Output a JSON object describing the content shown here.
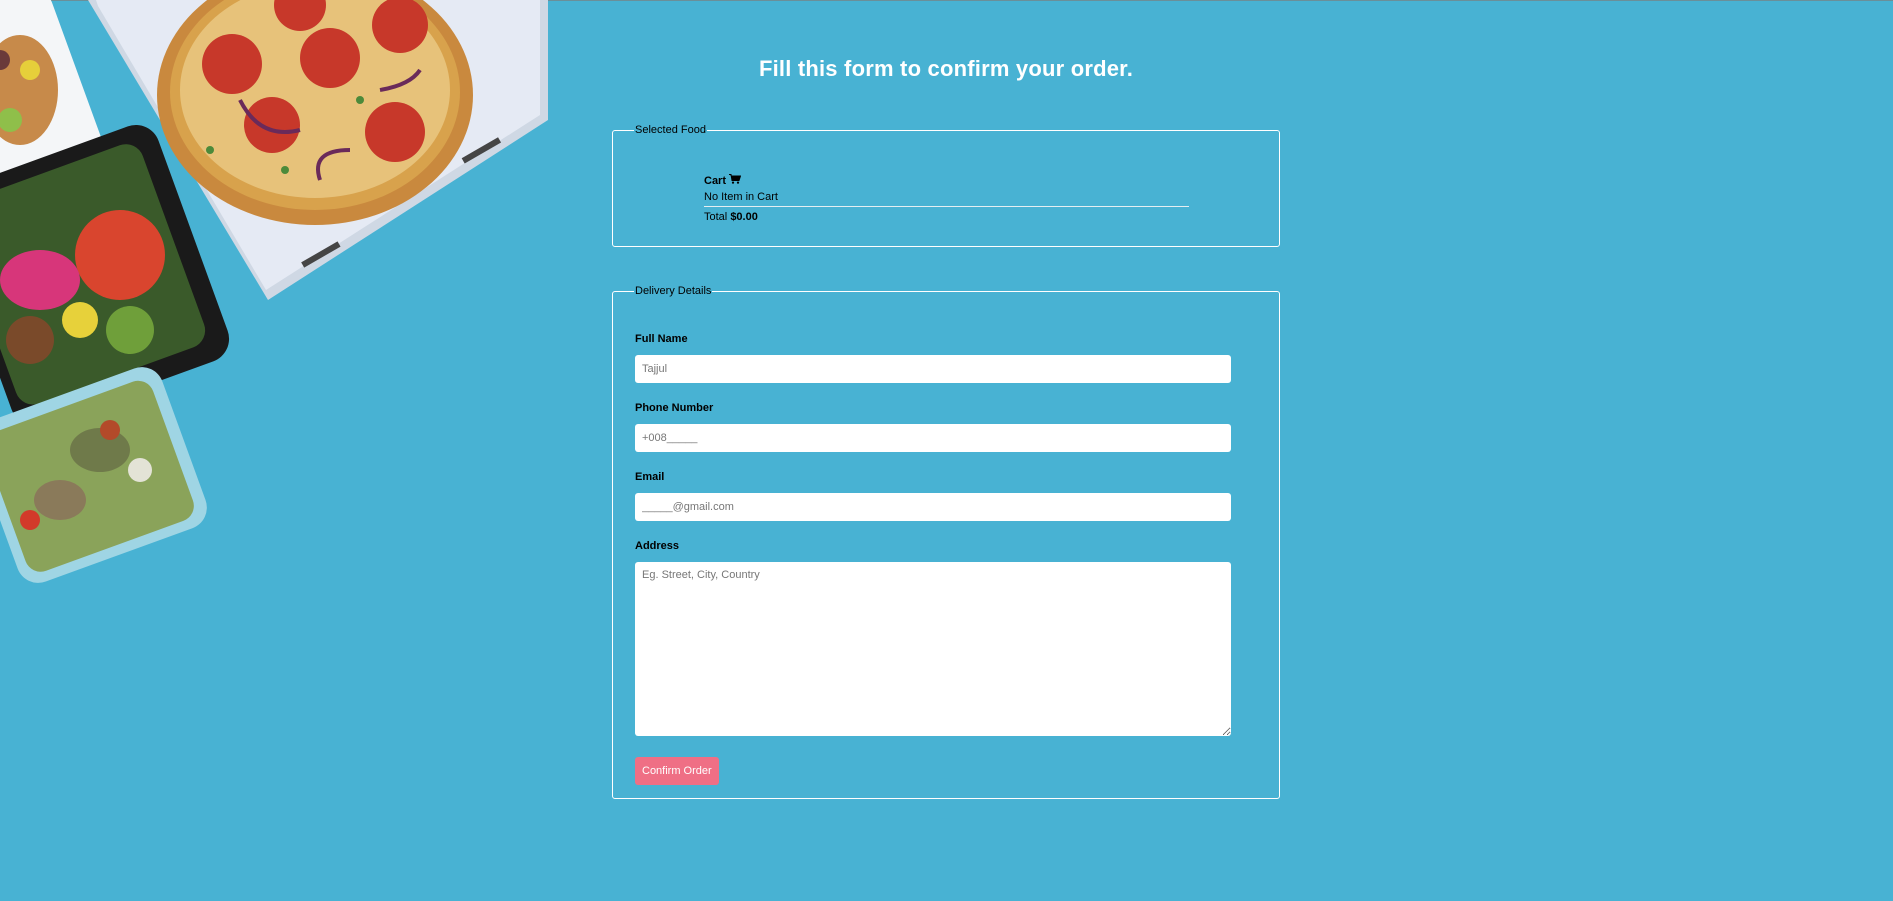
{
  "page": {
    "title": "Fill this form to confirm your order.",
    "background_color": "#48b2d3"
  },
  "selected_food": {
    "legend": "Selected Food",
    "cart_title": "Cart",
    "cart_icon": "shopping-cart-icon",
    "empty_message": "No Item in Cart",
    "total_label": "Total",
    "total_value": "$0.00"
  },
  "delivery": {
    "legend": "Delivery Details",
    "full_name": {
      "label": "Full Name",
      "placeholder": "Tajjul"
    },
    "phone": {
      "label": "Phone Number",
      "placeholder": "+008_____"
    },
    "email": {
      "label": "Email",
      "placeholder": "_____@gmail.com"
    },
    "address": {
      "label": "Address",
      "placeholder": "Eg. Street, City, Country"
    },
    "confirm_label": "Confirm Order",
    "confirm_color": "#ef6f85"
  },
  "decor": {
    "image": "food-delivery-photo"
  }
}
